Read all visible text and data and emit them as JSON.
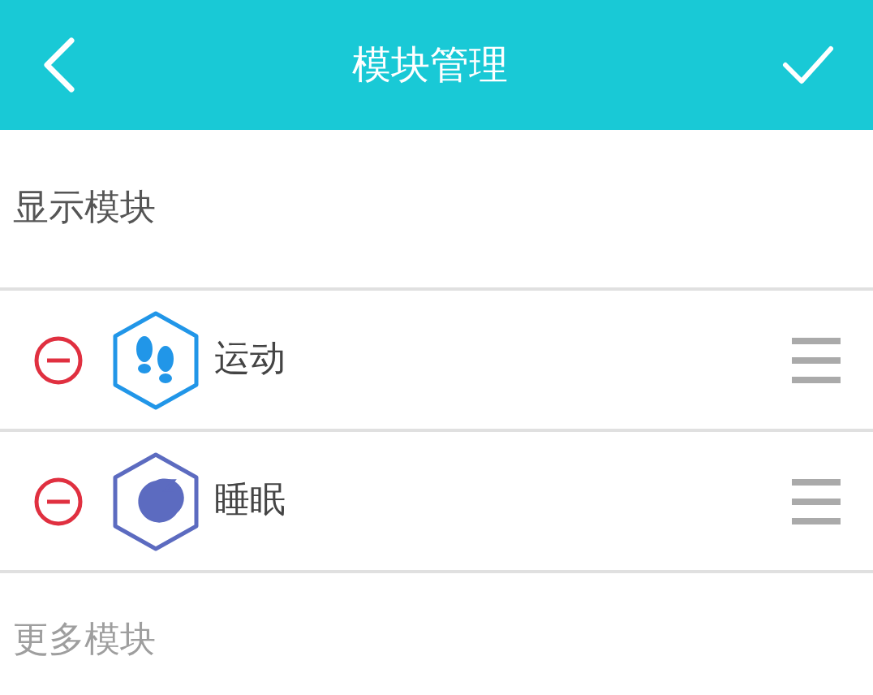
{
  "header": {
    "title": "模块管理"
  },
  "shown_section": {
    "title": "显示模块"
  },
  "modules": [
    {
      "kind": "steps",
      "name": "运动",
      "color": "#2196e8"
    },
    {
      "kind": "sleep",
      "name": "睡眠",
      "color": "#5c6bc0"
    }
  ],
  "more_section": {
    "title": "更多模块"
  }
}
